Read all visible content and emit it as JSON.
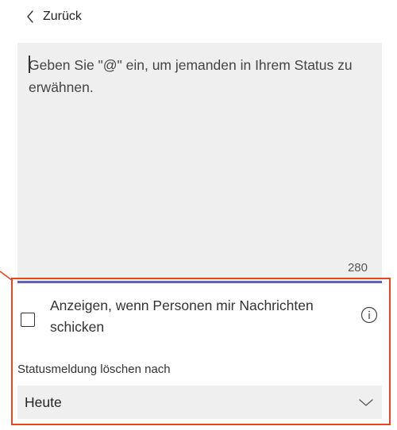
{
  "nav": {
    "back_label": "Zurück",
    "back_icon": "chevron-left-icon"
  },
  "status_editor": {
    "placeholder": "Geben Sie \"@\" ein, um jemanden in Ihrem Status zu erwähnen.",
    "value": "",
    "char_counter": "280",
    "accent_color": "#6264a7"
  },
  "show_when_messaging": {
    "label": "Anzeigen, wenn Personen mir Nachrichten schicken",
    "checked": false,
    "info_icon": "info-icon"
  },
  "clear_after": {
    "label": "Statusmeldung löschen nach",
    "selected": "Heute",
    "chevron_icon": "chevron-down-icon"
  },
  "annotation": {
    "highlight_color": "#e8441e"
  }
}
